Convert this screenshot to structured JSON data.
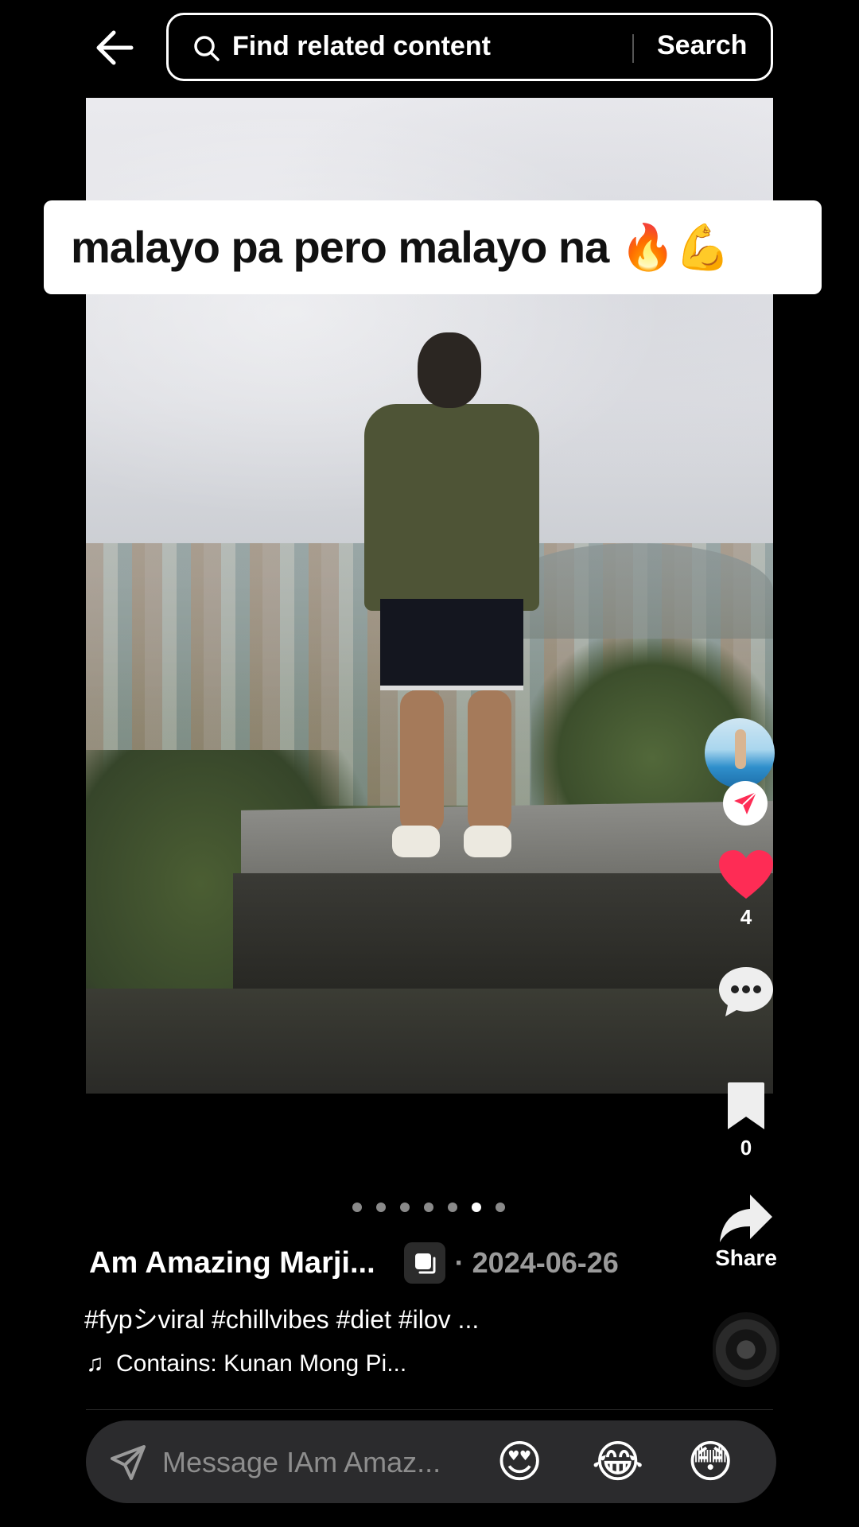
{
  "search": {
    "placeholder": "Find related content",
    "button_label": "Search"
  },
  "caption": {
    "text": "malayo pa pero malayo na 🔥💪"
  },
  "rail": {
    "likes": "4",
    "saves": "0",
    "share_label": "Share"
  },
  "carousel": {
    "total": 7,
    "active_index": 5
  },
  "post": {
    "author": "Am Amazing Marji...",
    "date": "· 2024-06-26",
    "hashtags": "#fypシviral #chillvibes #diet #ilov ...",
    "music": "Contains: Kunan Mong Pi..."
  },
  "message": {
    "placeholder": "Message IAm Amaz...",
    "emojis": [
      "😍",
      "😂",
      "😳"
    ]
  },
  "colors": {
    "like_red": "#fe2c55",
    "background": "#000000"
  },
  "icons": {
    "back": "arrow-left-icon",
    "search": "search-icon",
    "like": "heart-icon",
    "comment": "comment-icon",
    "save": "bookmark-icon",
    "share": "share-arrow-icon",
    "send": "send-icon",
    "music": "music-note-icon"
  }
}
